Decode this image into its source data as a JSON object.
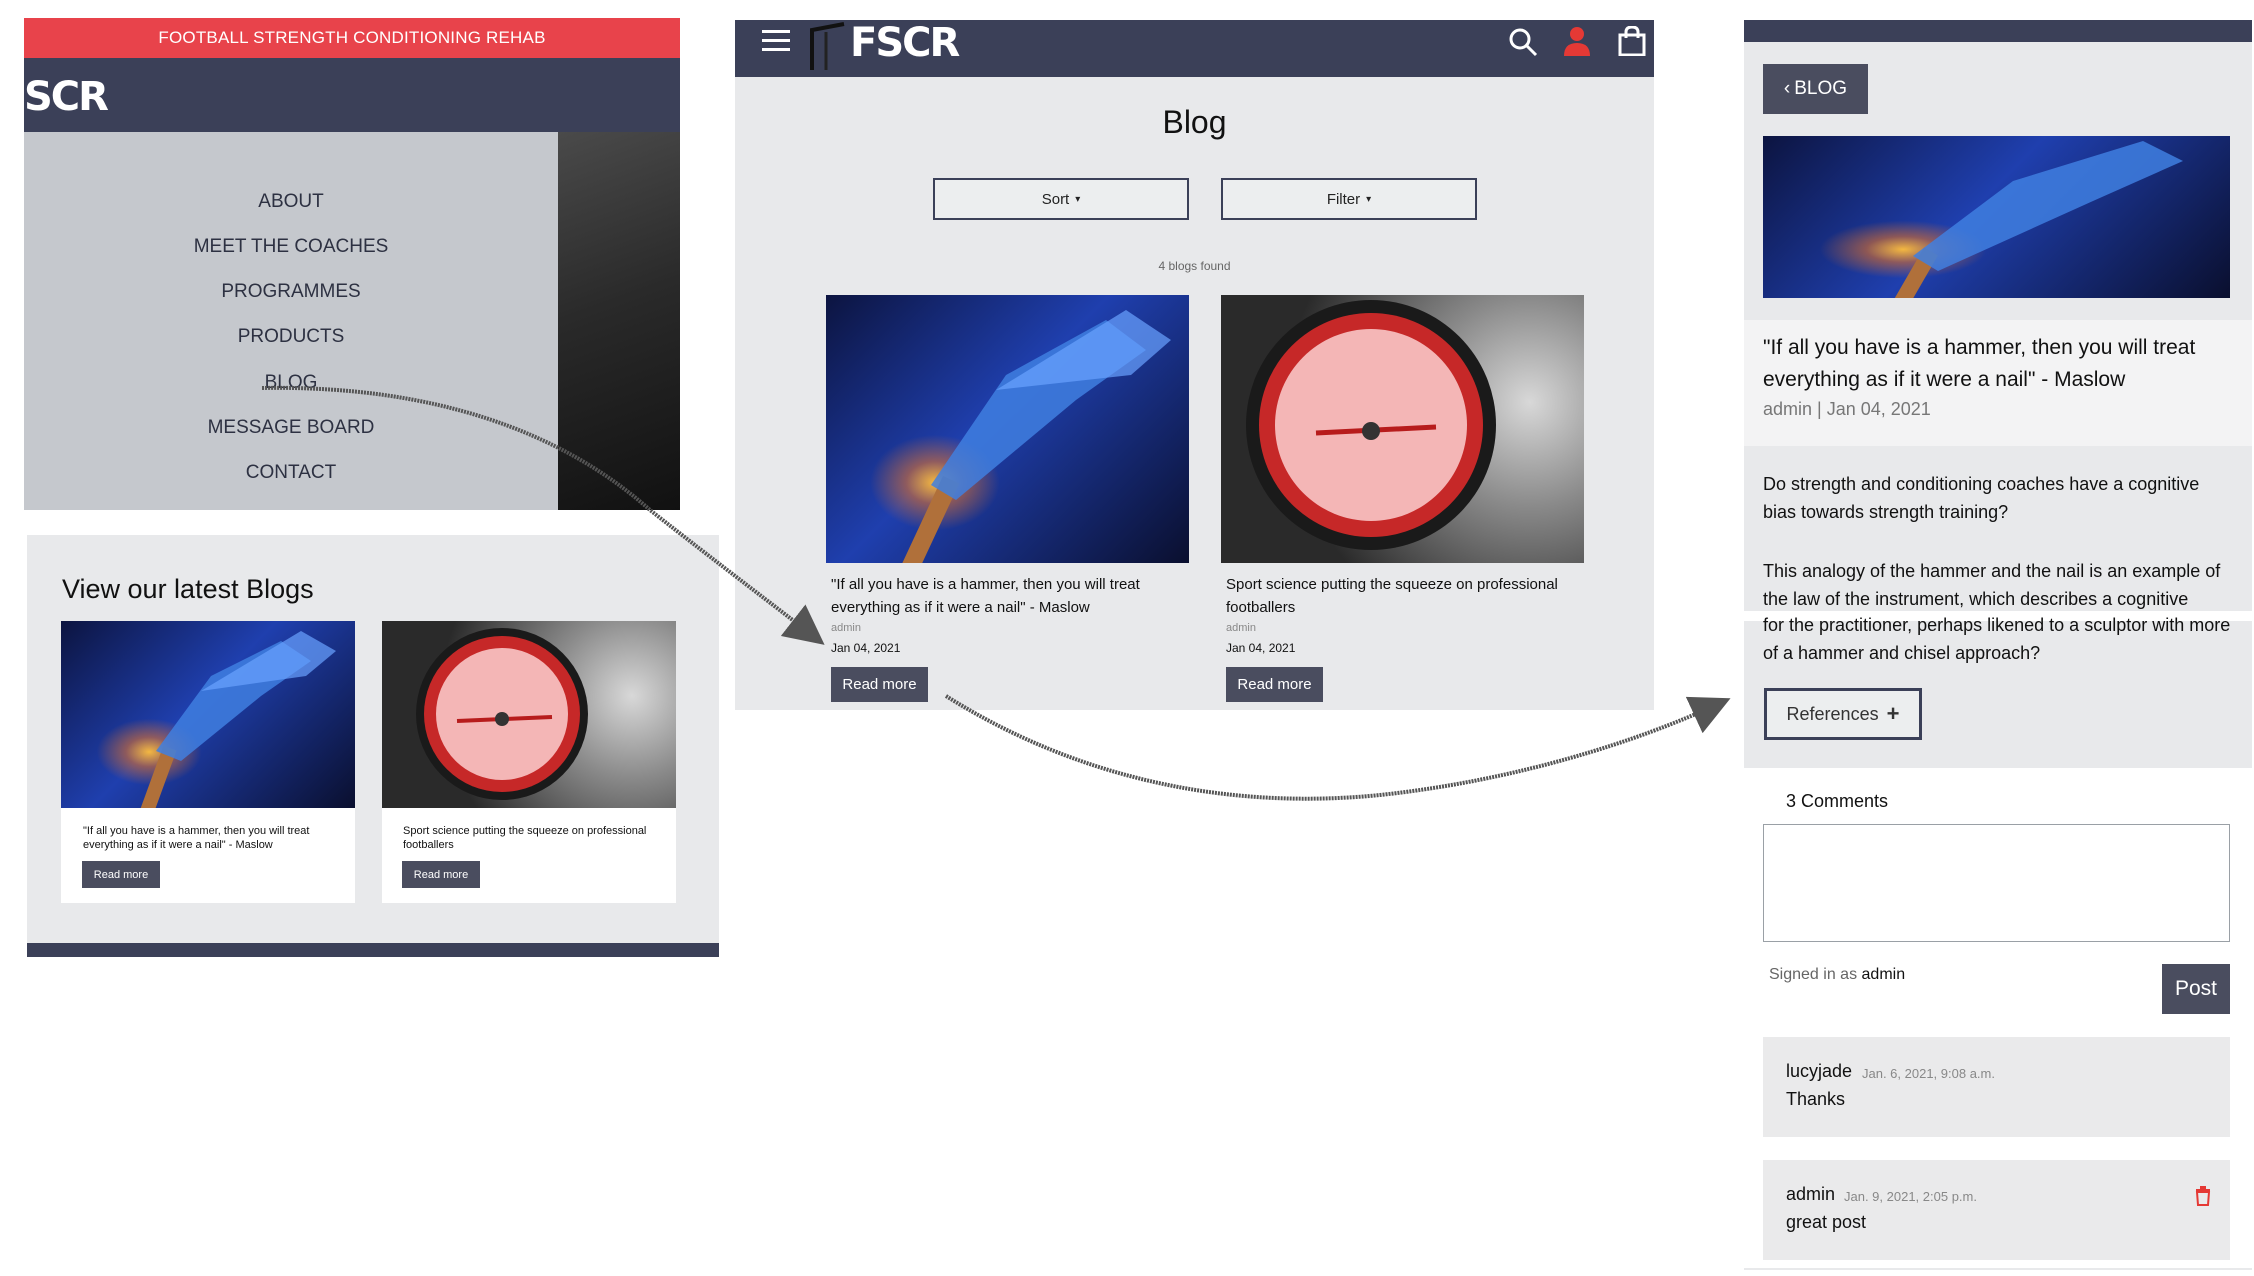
{
  "panel1": {
    "banner": "FOOTBALL STRENGTH CONDITIONING REHAB",
    "logo": "SCR",
    "menu": [
      "ABOUT",
      "MEET THE COACHES",
      "PROGRAMMES",
      "PRODUCTS",
      "BLOG",
      "MESSAGE BOARD",
      "CONTACT"
    ],
    "blogs_heading": "View our latest Blogs",
    "cards": [
      {
        "title": "\"If all you have is a hammer, then you will treat everything as if it were a nail\" - Maslow",
        "button": "Read more"
      },
      {
        "title": "Sport science putting the squeeze on professional footballers",
        "button": "Read more"
      }
    ]
  },
  "panel2": {
    "logo": "FSCR",
    "title": "Blog",
    "sort_label": "Sort",
    "filter_label": "Filter",
    "found": "4 blogs found",
    "cards": [
      {
        "title": "\"If all you have is a hammer, then you will treat everything as if it were a nail\" - Maslow",
        "author": "admin",
        "date": "Jan 04, 2021",
        "button": "Read more"
      },
      {
        "title": "Sport science putting the squeeze on professional footballers",
        "author": "admin",
        "date": "Jan 04, 2021",
        "button": "Read more"
      }
    ]
  },
  "panel3": {
    "back_label": "BLOG",
    "title": "\"If all you have is a hammer, then you will treat everything as if it were a nail\" - Maslow",
    "meta": "admin | Jan 04, 2021",
    "para1": "Do strength and conditioning coaches have a cognitive bias towards strength training?",
    "para2": "This analogy of the hammer and the nail is an example of the law of the instrument, which describes a cognitive",
    "para3": "for the practitioner, perhaps likened to a sculptor with more of a hammer and chisel approach?",
    "references_label": "References",
    "comment_count": "3 Comments",
    "signed_in_prefix": "Signed in as",
    "signed_in_user": "admin",
    "post_label": "Post",
    "comments": [
      {
        "user": "lucyjade",
        "date": "Jan. 6, 2021, 9:08 a.m.",
        "body": "Thanks"
      },
      {
        "user": "admin",
        "date": "Jan. 9, 2021, 2:05 p.m.",
        "body": "great post"
      }
    ]
  },
  "colors": {
    "navy": "#3b4058",
    "banner_red": "#e8434b",
    "accent_red": "#e53935",
    "button_dark": "#4a4d5f"
  }
}
